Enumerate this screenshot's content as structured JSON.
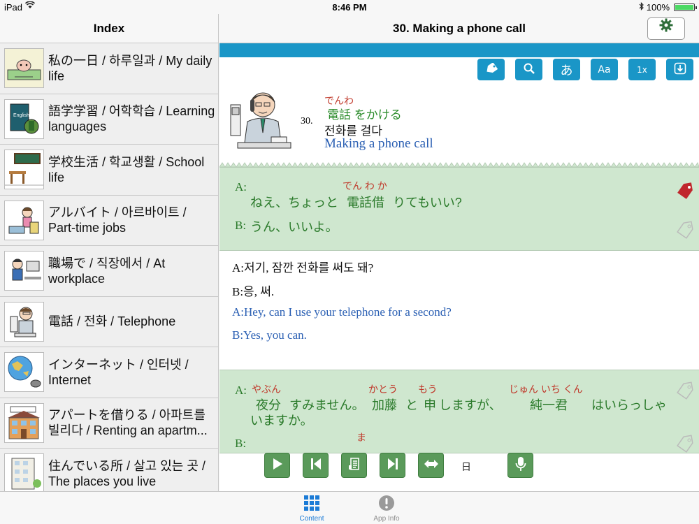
{
  "status_bar": {
    "carrier": "iPad",
    "time": "8:46 PM",
    "battery": "100%"
  },
  "sidebar": {
    "title": "Index",
    "items": [
      {
        "label": "私の一日 / 하루일과 / My daily life",
        "icon": "cow-illustration-icon"
      },
      {
        "label": "語学学習 / 어학학습 / Learning languages",
        "icon": "english-book-icon"
      },
      {
        "label": "学校生活 / 학교생활 / School life",
        "icon": "classroom-icon"
      },
      {
        "label": "アルバイト / 아르바이트 / Part-time jobs",
        "icon": "cashier-icon"
      },
      {
        "label": "職場で / 직장에서 / At workplace",
        "icon": "office-worker-icon"
      },
      {
        "label": "電話 / 전화 / Telephone",
        "icon": "telephone-man-icon"
      },
      {
        "label": "インターネット / 인터넷 / Internet",
        "icon": "globe-mouse-icon"
      },
      {
        "label": "アパートを借りる / 아파트를 빌리다 / Renting an apartm...",
        "icon": "apartment-house-icon"
      },
      {
        "label": "住んでいる所 / 살고 있는 곳 / The places you live",
        "icon": "building-icon"
      }
    ]
  },
  "main": {
    "title": "30. Making a phone call",
    "toolbar": {
      "kana_label": "あ",
      "font_label": "Aa",
      "speed_label": "1x"
    },
    "lesson": {
      "number": "30.",
      "ruby": "でんわ",
      "japanese": "電話 をかける",
      "korean": "전화를 걸다",
      "english": "Making a phone call"
    },
    "dialog1": {
      "a_speaker": "A:",
      "a_ruby": "でん わ か",
      "a_text_1": "ねえ、ちょっと",
      "a_text_2": "電話借",
      "a_text_3": "りてもいい?",
      "b_speaker": "B:",
      "b_text": "うん、いいよ。"
    },
    "translation": {
      "kr_a": "A:저기, 잠깐 전화를 써도 돼?",
      "kr_b": "B:응, 써.",
      "en_a": "A:Hey, can I use your telephone for a second?",
      "en_b": "B:Yes, you can."
    },
    "dialog2": {
      "a_speaker": "A:",
      "ruby_1": "やぶん",
      "ruby_2": "かとう",
      "ruby_3": "もう",
      "ruby_4": "じゅん いち くん",
      "w1": "夜分",
      "w2": "すみません。",
      "w3": "加藤",
      "w4": "と",
      "w5": "申",
      "w6": "しますが、",
      "w7": "純一君",
      "w8": "はいらっしゃ",
      "line2": "いますか。",
      "b_speaker": "B:",
      "b_ruby": "ま"
    }
  },
  "player": {
    "char": "日"
  },
  "tabs": [
    {
      "label": "Content",
      "active": true
    },
    {
      "label": "App Info",
      "active": false
    }
  ],
  "colors": {
    "accent_blue": "#1a96c7",
    "jp_green": "#2a7a2a",
    "ruby_red": "#c0392b",
    "english_blue": "#2a5fb3",
    "jp_block_bg": "#cfe7cf",
    "tab_active": "#1b7bd6"
  }
}
